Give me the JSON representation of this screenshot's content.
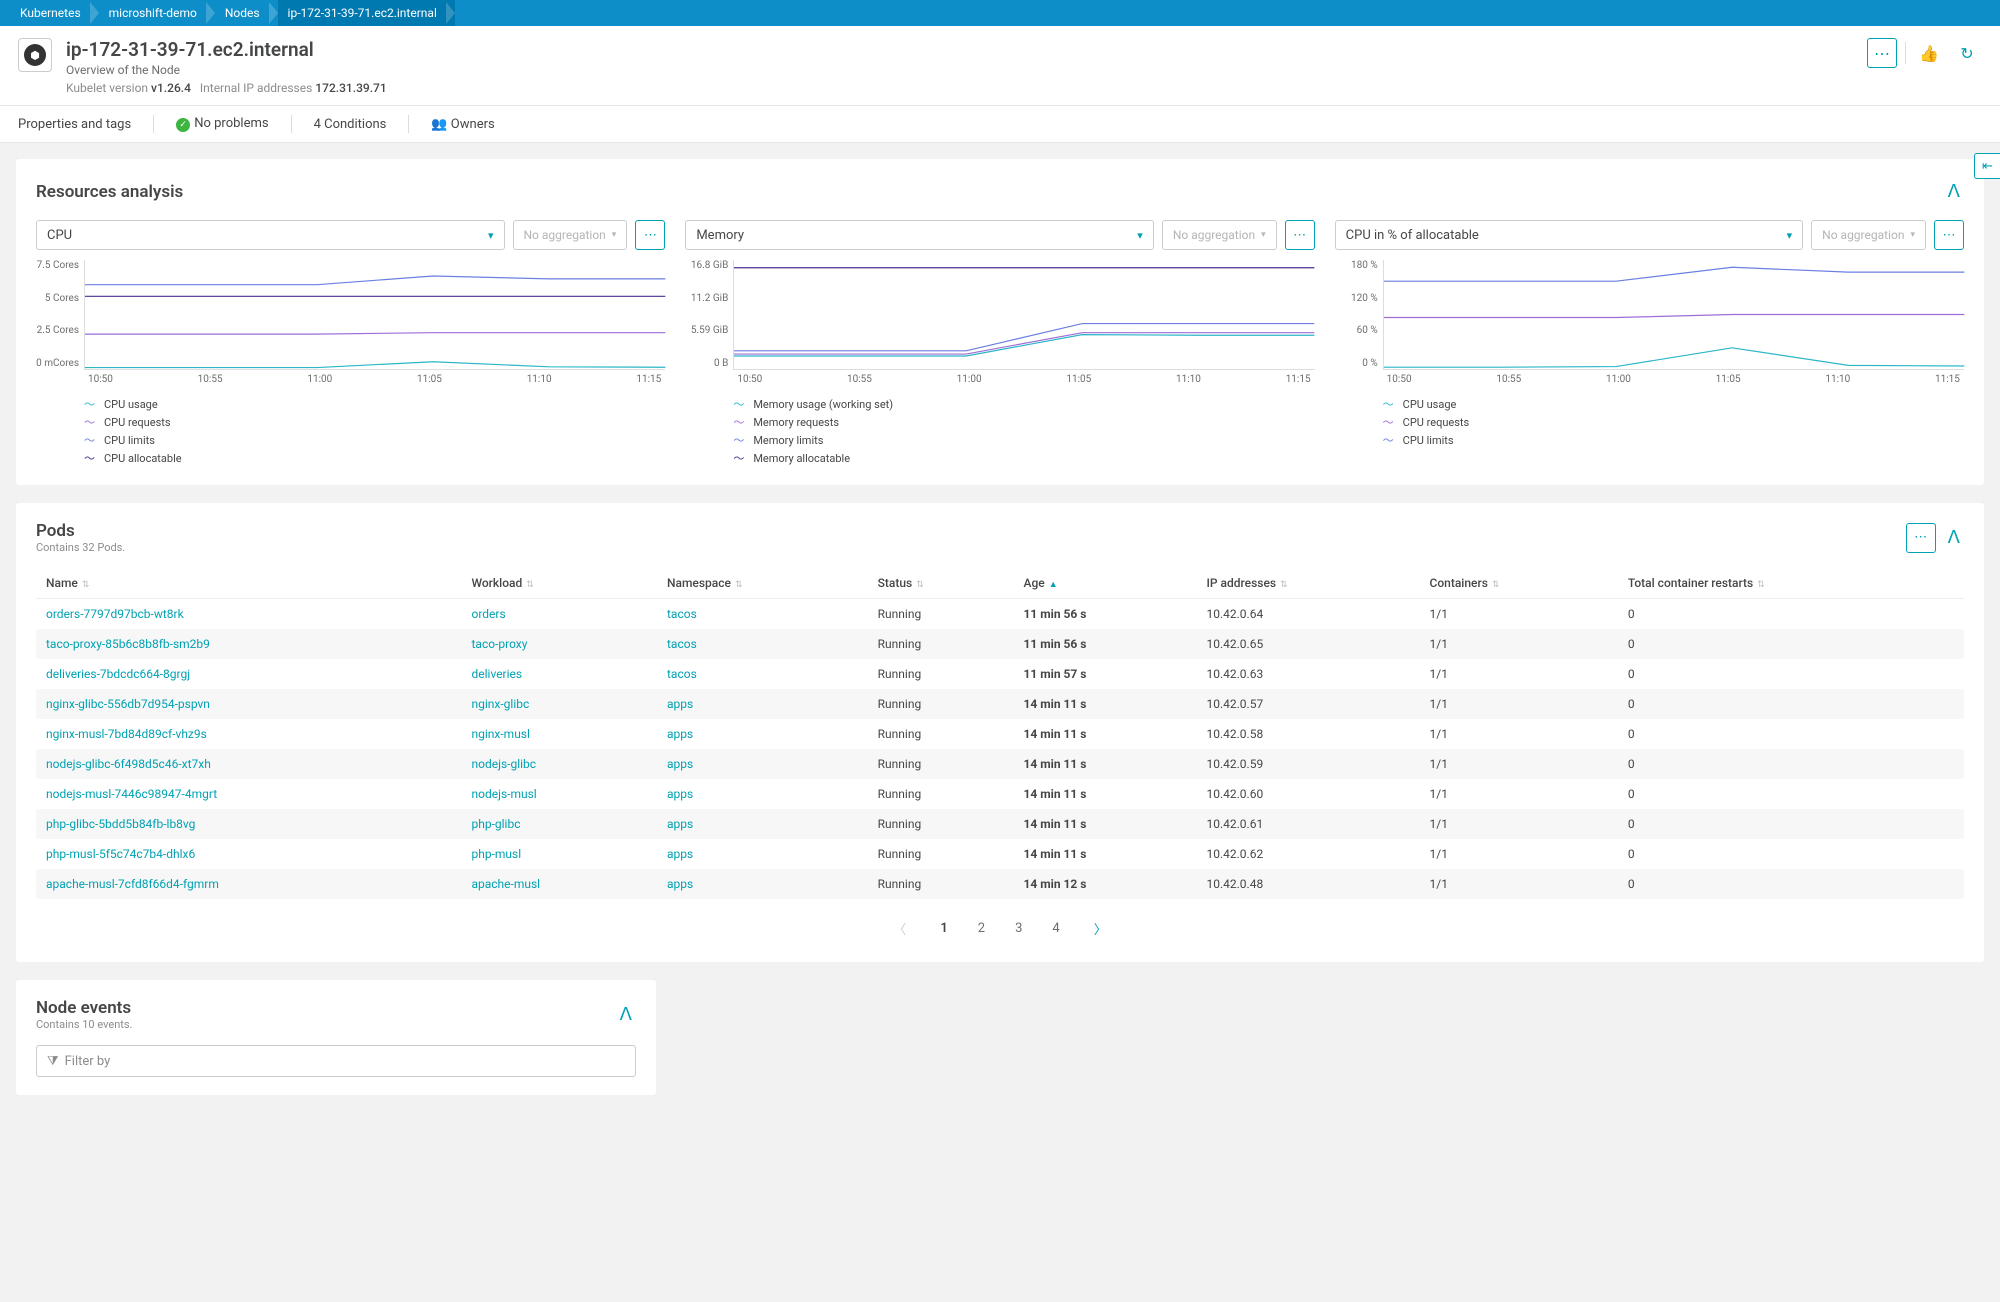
{
  "breadcrumb": [
    "Kubernetes",
    "microshift-demo",
    "Nodes",
    "ip-172-31-39-71.ec2.internal"
  ],
  "header": {
    "title": "ip-172-31-39-71.ec2.internal",
    "subtitle": "Overview of the Node",
    "kubelet_label": "Kubelet version",
    "kubelet_version": "v1.26.4",
    "ip_label": "Internal IP addresses",
    "ip_value": "172.31.39.71"
  },
  "infobar": {
    "properties": "Properties and tags",
    "status": "No problems",
    "conditions": "4 Conditions",
    "owners": "Owners"
  },
  "resources_panel": {
    "title": "Resources analysis",
    "no_aggregation": "No aggregation",
    "charts": [
      {
        "select": "CPU",
        "y": [
          "7.5 Cores",
          "5 Cores",
          "2.5 Cores",
          "0 mCores"
        ],
        "x": [
          "10:50",
          "10:55",
          "11:00",
          "11:05",
          "11:10",
          "11:15"
        ],
        "legend": [
          "CPU usage",
          "CPU requests",
          "CPU limits",
          "CPU allocatable"
        ]
      },
      {
        "select": "Memory",
        "y": [
          "16.8 GiB",
          "11.2 GiB",
          "5.59 GiB",
          "0 B"
        ],
        "x": [
          "10:50",
          "10:55",
          "11:00",
          "11:05",
          "11:10",
          "11:15"
        ],
        "legend": [
          "Memory usage (working set)",
          "Memory requests",
          "Memory limits",
          "Memory allocatable"
        ]
      },
      {
        "select": "CPU in % of allocatable",
        "y": [
          "180 %",
          "120 %",
          "60 %",
          "0 %"
        ],
        "x": [
          "10:50",
          "10:55",
          "11:00",
          "11:05",
          "11:10",
          "11:15"
        ],
        "legend": [
          "CPU usage",
          "CPU requests",
          "CPU limits"
        ]
      }
    ]
  },
  "chart_data": [
    {
      "type": "line",
      "title": "CPU",
      "xlabel": "",
      "ylabel": "",
      "x": [
        "10:50",
        "10:55",
        "11:00",
        "11:05",
        "11:10",
        "11:15"
      ],
      "ylim": [
        0,
        7.5
      ],
      "y_unit": "Cores",
      "series": [
        {
          "name": "CPU usage",
          "color": "#2ab6c7",
          "values": [
            0.1,
            0.1,
            0.1,
            0.5,
            0.15,
            0.12
          ]
        },
        {
          "name": "CPU requests",
          "color": "#9e6dd8",
          "values": [
            2.4,
            2.4,
            2.4,
            2.5,
            2.5,
            2.5
          ]
        },
        {
          "name": "CPU limits",
          "color": "#6b7fe3",
          "values": [
            5.8,
            5.8,
            5.8,
            6.4,
            6.2,
            6.2
          ]
        },
        {
          "name": "CPU allocatable",
          "color": "#4a2f8f",
          "values": [
            5.0,
            5.0,
            5.0,
            5.0,
            5.0,
            5.0
          ]
        }
      ]
    },
    {
      "type": "line",
      "title": "Memory",
      "x": [
        "10:50",
        "10:55",
        "11:00",
        "11:05",
        "11:10",
        "11:15"
      ],
      "ylim": [
        0,
        16.8
      ],
      "y_unit": "GiB",
      "series": [
        {
          "name": "Memory usage (working set)",
          "color": "#2ab6c7",
          "values": [
            2.0,
            2.0,
            2.0,
            5.3,
            5.2,
            5.2
          ]
        },
        {
          "name": "Memory requests",
          "color": "#9e6dd8",
          "values": [
            2.3,
            2.3,
            2.3,
            5.6,
            5.6,
            5.6
          ]
        },
        {
          "name": "Memory limits",
          "color": "#6b7fe3",
          "values": [
            2.8,
            2.8,
            2.8,
            7.0,
            7.0,
            7.0
          ]
        },
        {
          "name": "Memory allocatable",
          "color": "#4a2f8f",
          "values": [
            15.6,
            15.6,
            15.6,
            15.6,
            15.6,
            15.6
          ]
        }
      ]
    },
    {
      "type": "line",
      "title": "CPU in % of allocatable",
      "x": [
        "10:50",
        "10:55",
        "11:00",
        "11:05",
        "11:10",
        "11:15"
      ],
      "ylim": [
        0,
        180
      ],
      "y_unit": "%",
      "series": [
        {
          "name": "CPU usage",
          "color": "#2ab6c7",
          "values": [
            3,
            3,
            4,
            35,
            6,
            5
          ]
        },
        {
          "name": "CPU requests",
          "color": "#9e6dd8",
          "values": [
            85,
            85,
            85,
            90,
            90,
            90
          ]
        },
        {
          "name": "CPU limits",
          "color": "#6b7fe3",
          "values": [
            145,
            145,
            145,
            168,
            160,
            160
          ]
        }
      ]
    }
  ],
  "pods_panel": {
    "title": "Pods",
    "subtitle": "Contains 32 Pods.",
    "columns": [
      "Name",
      "Workload",
      "Namespace",
      "Status",
      "Age",
      "IP addresses",
      "Containers",
      "Total container restarts"
    ],
    "sorted_col": 4,
    "rows": [
      {
        "name": "orders-7797d97bcb-wt8rk",
        "workload": "orders",
        "ns": "tacos",
        "status": "Running",
        "age": "11 min 56 s",
        "ip": "10.42.0.64",
        "containers": "1/1",
        "restarts": "0"
      },
      {
        "name": "taco-proxy-85b6c8b8fb-sm2b9",
        "workload": "taco-proxy",
        "ns": "tacos",
        "status": "Running",
        "age": "11 min 56 s",
        "ip": "10.42.0.65",
        "containers": "1/1",
        "restarts": "0"
      },
      {
        "name": "deliveries-7bdcdc664-8grgj",
        "workload": "deliveries",
        "ns": "tacos",
        "status": "Running",
        "age": "11 min 57 s",
        "ip": "10.42.0.63",
        "containers": "1/1",
        "restarts": "0"
      },
      {
        "name": "nginx-glibc-556db7d954-pspvn",
        "workload": "nginx-glibc",
        "ns": "apps",
        "status": "Running",
        "age": "14 min 11 s",
        "ip": "10.42.0.57",
        "containers": "1/1",
        "restarts": "0"
      },
      {
        "name": "nginx-musl-7bd84d89cf-vhz9s",
        "workload": "nginx-musl",
        "ns": "apps",
        "status": "Running",
        "age": "14 min 11 s",
        "ip": "10.42.0.58",
        "containers": "1/1",
        "restarts": "0"
      },
      {
        "name": "nodejs-glibc-6f498d5c46-xt7xh",
        "workload": "nodejs-glibc",
        "ns": "apps",
        "status": "Running",
        "age": "14 min 11 s",
        "ip": "10.42.0.59",
        "containers": "1/1",
        "restarts": "0"
      },
      {
        "name": "nodejs-musl-7446c98947-4mgrt",
        "workload": "nodejs-musl",
        "ns": "apps",
        "status": "Running",
        "age": "14 min 11 s",
        "ip": "10.42.0.60",
        "containers": "1/1",
        "restarts": "0"
      },
      {
        "name": "php-glibc-5bdd5b84fb-lb8vg",
        "workload": "php-glibc",
        "ns": "apps",
        "status": "Running",
        "age": "14 min 11 s",
        "ip": "10.42.0.61",
        "containers": "1/1",
        "restarts": "0"
      },
      {
        "name": "php-musl-5f5c74c7b4-dhlx6",
        "workload": "php-musl",
        "ns": "apps",
        "status": "Running",
        "age": "14 min 11 s",
        "ip": "10.42.0.62",
        "containers": "1/1",
        "restarts": "0"
      },
      {
        "name": "apache-musl-7cfd8f66d4-fgmrm",
        "workload": "apache-musl",
        "ns": "apps",
        "status": "Running",
        "age": "14 min 12 s",
        "ip": "10.42.0.48",
        "containers": "1/1",
        "restarts": "0"
      }
    ],
    "pages": [
      "1",
      "2",
      "3",
      "4"
    ],
    "current_page": "1"
  },
  "events_panel": {
    "title": "Node events",
    "subtitle": "Contains 10 events.",
    "filter_placeholder": "Filter by"
  }
}
